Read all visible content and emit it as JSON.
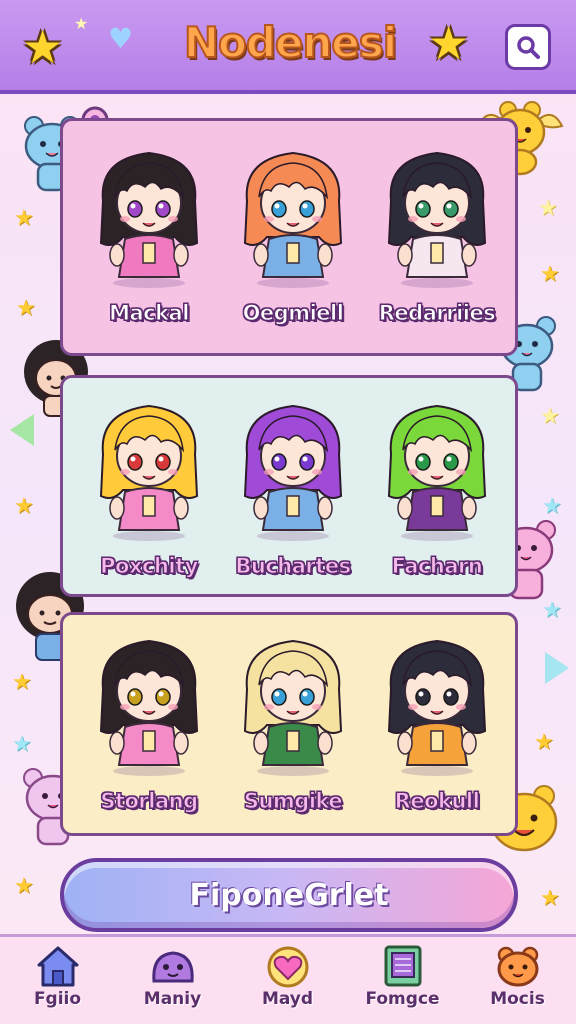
{
  "header": {
    "title": "Nodenesi",
    "title_suffix_badge": "i",
    "left_icons": [
      "star-icon",
      "small-star-icon",
      "heart-icon"
    ],
    "right_icons": [
      "star-icon",
      "search-icon"
    ]
  },
  "cards": [
    {
      "background": "#f6c3e4",
      "characters": [
        {
          "name": "Mackal",
          "hair": "#2b2325",
          "outfit": "#f07ac0",
          "eyes": "#a048c8"
        },
        {
          "name": "Oegmiell",
          "hair": "#f58a55",
          "outfit": "#7ab0e6",
          "eyes": "#3aa0d8"
        },
        {
          "name": "Redarriies",
          "hair": "#2c2c3a",
          "outfit": "#f5e6f0",
          "eyes": "#3a9a6a"
        }
      ]
    },
    {
      "background": "#e2efef",
      "characters": [
        {
          "name": "Poxchity",
          "hair": "#ffcb3a",
          "outfit": "#f58ac8",
          "eyes": "#d83a3a"
        },
        {
          "name": "Buchartes",
          "hair": "#a04ad8",
          "outfit": "#7ab0e6",
          "eyes": "#7a3ad0"
        },
        {
          "name": "Facharn",
          "hair": "#7ad83a",
          "outfit": "#7a3a9a",
          "eyes": "#2a9a4a"
        }
      ]
    },
    {
      "background": "#fbeec6",
      "characters": [
        {
          "name": "Storlang",
          "hair": "#2b2325",
          "outfit": "#f58ac8",
          "eyes": "#c8a020"
        },
        {
          "name": "Sumgike",
          "hair": "#f5e2a0",
          "outfit": "#3a8a4a",
          "eyes": "#3aa0d8"
        },
        {
          "name": "Reokull",
          "hair": "#2c2c3a",
          "outfit": "#f5a23a",
          "eyes": "#2c2c3a"
        }
      ]
    }
  ],
  "primary_button": {
    "label": "FiponeGrlet"
  },
  "nav": [
    {
      "label": "Fgiio",
      "icon": "home-icon"
    },
    {
      "label": "Maniy",
      "icon": "slime-icon"
    },
    {
      "label": "Mayd",
      "icon": "heart-icon"
    },
    {
      "label": "Fomgce",
      "icon": "book-icon"
    },
    {
      "label": "Mocis",
      "icon": "bear-icon"
    }
  ],
  "colors": {
    "header": "#b57fe8",
    "accent": "#7c4a8c",
    "title": "#ffa64d"
  }
}
